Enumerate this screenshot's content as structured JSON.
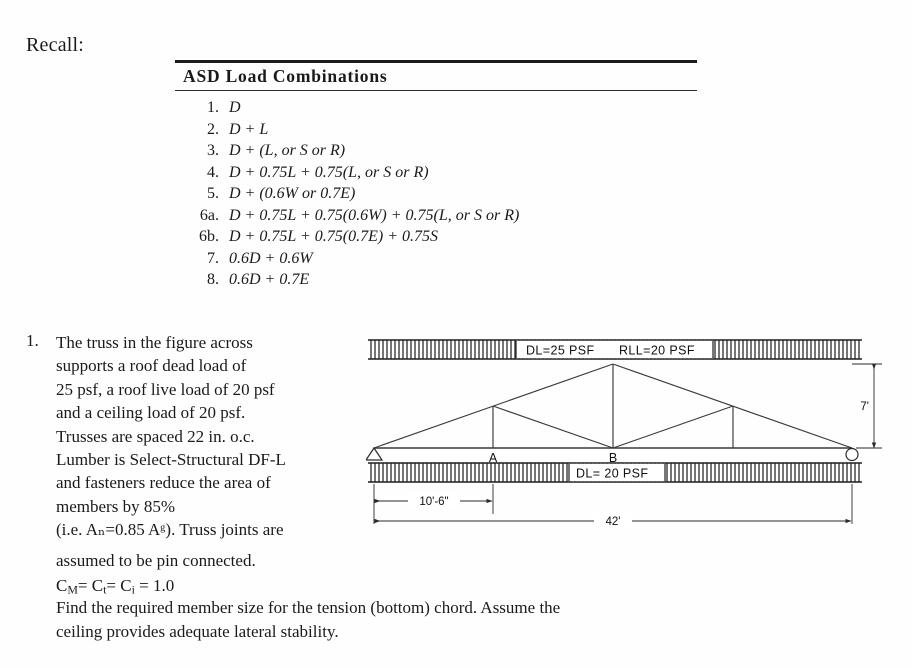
{
  "document": {
    "recall_label": "Recall:"
  },
  "asd_table": {
    "title": "ASD Load Combinations",
    "rows": [
      {
        "num": "1.",
        "equation": "D"
      },
      {
        "num": "2.",
        "equation": "D + L"
      },
      {
        "num": "3.",
        "equation": "D + (L, or S or R)"
      },
      {
        "num": "4.",
        "equation": "D + 0.75L + 0.75(L, or S or R)"
      },
      {
        "num": "5.",
        "equation": "D + (0.6W or 0.7E)"
      },
      {
        "num": "6a.",
        "equation": "D + 0.75L + 0.75(0.6W) + 0.75(L, or S or R)"
      },
      {
        "num": "6b.",
        "equation": "D + 0.75L + 0.75(0.7E) + 0.75S"
      },
      {
        "num": "7.",
        "equation": "0.6D + 0.6W"
      },
      {
        "num": "8.",
        "equation": "0.6D + 0.7E"
      }
    ]
  },
  "problem": {
    "number": "1.",
    "paragraph_lines": [
      "The truss in the figure across",
      "supports a roof dead load of",
      "25 psf, a roof live load of 20 psf",
      "and a ceiling load of 20 psf.",
      "Trusses are spaced 22 in. o.c.",
      "Lumber is Select-Structural DF-L",
      "and fasteners reduce the area of",
      "members by 85%",
      "(i.e. Aₙ=0.85 Aᵍ).  Truss joints are"
    ],
    "assumed_line": "assumed to be pin connected.",
    "coefficients_line": "CM= Ct= Ci = 1.0",
    "coefficients_parts": {
      "c_m": "C",
      "sub_m": "M",
      "c_t": "C",
      "sub_t": "t",
      "c_i": "C",
      "sub_i": "i",
      "value": "1.0",
      "eq1": "=",
      "eq2": "=",
      "eq3": "="
    },
    "question_lines": [
      "Find the required member size for the tension (bottom) chord.  Assume the",
      "ceiling provides adequate lateral stability."
    ]
  },
  "figure": {
    "top_load_label": "DL=25 PSF    RLL=20 PSF",
    "top_load_label_parts": {
      "dl": "DL=25 PSF",
      "rll": "RLL=20 PSF"
    },
    "bottom_load_label": "DL= 20 PSF",
    "joint_labels": [
      {
        "name": "A",
        "text": "A"
      },
      {
        "name": "B",
        "text": "B"
      }
    ],
    "dimensions": {
      "panel": "10'-6\"",
      "span": "42'",
      "height": "7'"
    },
    "supports": {
      "left": "pin-support",
      "right": "roller-support"
    },
    "colors": {
      "line": "#2b2b2b",
      "hatch": "#3a3a3a"
    }
  }
}
